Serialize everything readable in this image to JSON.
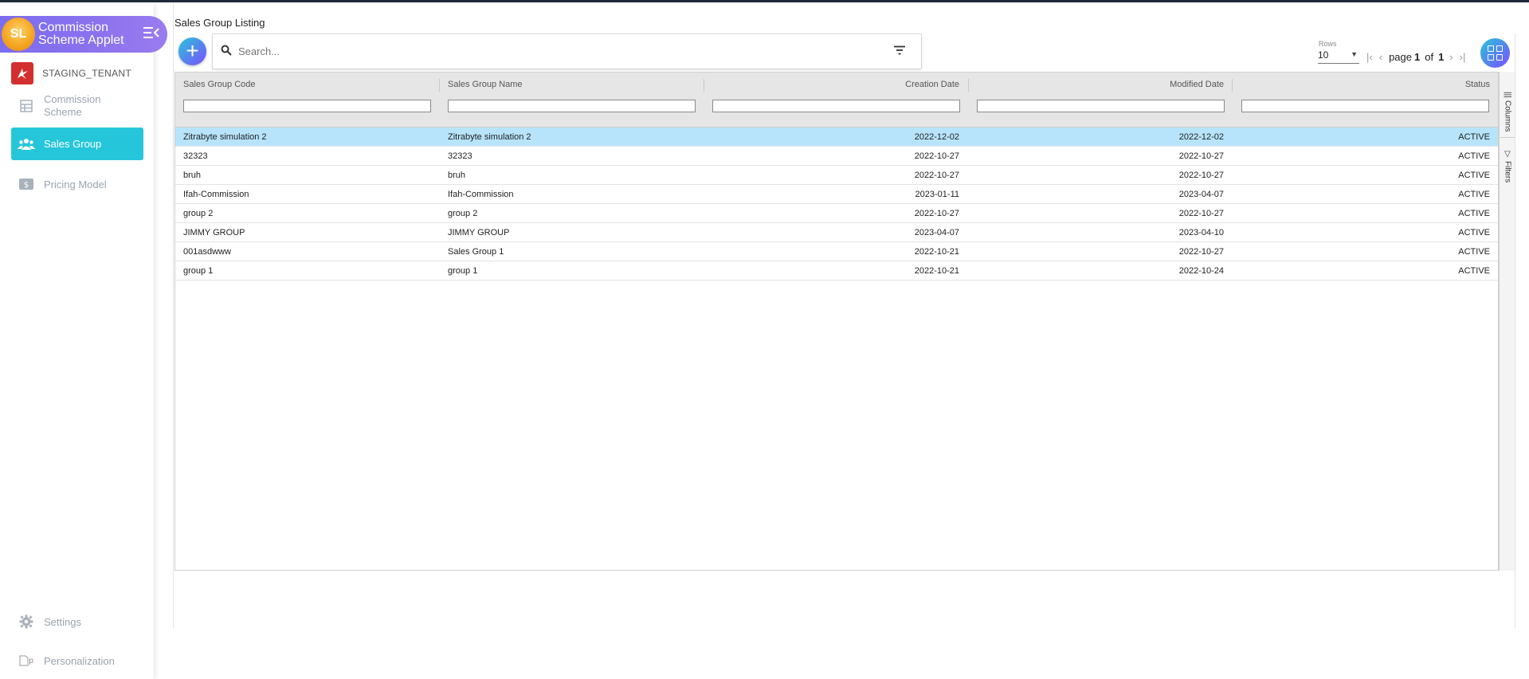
{
  "app": {
    "title": "Commission Scheme Applet",
    "logo_text": "SL"
  },
  "tenant": {
    "name": "STAGING_TENANT"
  },
  "sidebar": {
    "items": [
      {
        "label": "Commission Scheme",
        "icon": "table-icon"
      },
      {
        "label": "Sales Group",
        "icon": "users-icon"
      },
      {
        "label": "Pricing Model",
        "icon": "dollar-icon"
      }
    ],
    "settings": "Settings",
    "personalization": "Personalization",
    "broken_image_alt": "p"
  },
  "page": {
    "title": "Sales Group Listing"
  },
  "search": {
    "placeholder": "Search..."
  },
  "pagination": {
    "rows_label": "Rows",
    "rows_value": "10",
    "page_label": "page",
    "current": "1",
    "of_label": "of",
    "total": "1"
  },
  "table": {
    "columns": [
      "Sales Group Code",
      "Sales Group Name",
      "Creation Date",
      "Modified Date",
      "Status"
    ],
    "rows": [
      [
        "Zitrabyte simulation 2",
        "Zitrabyte simulation 2",
        "2022-12-02",
        "2022-12-02",
        "ACTIVE"
      ],
      [
        "32323",
        "32323",
        "2022-10-27",
        "2022-10-27",
        "ACTIVE"
      ],
      [
        "bruh",
        "bruh",
        "2022-10-27",
        "2022-10-27",
        "ACTIVE"
      ],
      [
        "Ifah-Commission",
        "Ifah-Commission",
        "2023-01-11",
        "2023-04-07",
        "ACTIVE"
      ],
      [
        "group 2",
        "group 2",
        "2022-10-27",
        "2022-10-27",
        "ACTIVE"
      ],
      [
        "JIMMY GROUP",
        "JIMMY GROUP",
        "2023-04-07",
        "2023-04-10",
        "ACTIVE"
      ],
      [
        "001asdwww",
        "Sales Group 1",
        "2022-10-21",
        "2022-10-27",
        "ACTIVE"
      ],
      [
        "group 1",
        "group 1",
        "2022-10-21",
        "2022-10-24",
        "ACTIVE"
      ]
    ],
    "selected_row": 0
  },
  "side_panel": {
    "columns": "Columns",
    "filters": "Filters"
  },
  "colors": {
    "accent": "#26c6da",
    "brand": "#8c72ee",
    "selected_row": "#b7e4fb"
  }
}
